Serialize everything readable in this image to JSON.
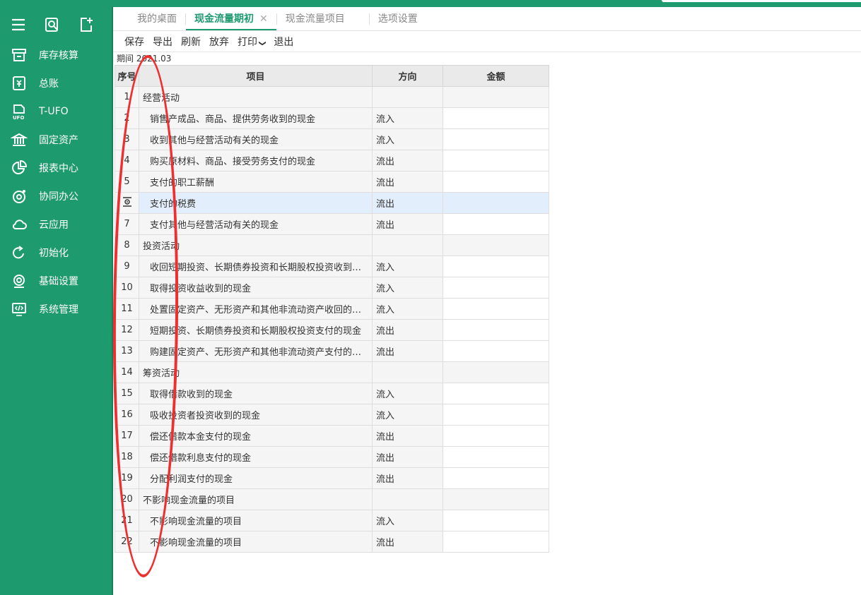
{
  "colors": {
    "brand": "#1e9a6f",
    "selected_row": "#e2eefb",
    "annotation": "#ee2f2f"
  },
  "sidebar": {
    "tools": [
      {
        "icon": "hamburger-icon"
      },
      {
        "icon": "search-doc-icon"
      },
      {
        "icon": "add-doc-icon"
      }
    ],
    "items": [
      {
        "label": "库存核算",
        "icon": "inventory-icon"
      },
      {
        "label": "总账",
        "icon": "ledger-icon"
      },
      {
        "label": "T-UFO",
        "icon": "ufo-icon"
      },
      {
        "label": "固定资产",
        "icon": "bank-icon"
      },
      {
        "label": "报表中心",
        "icon": "pie-chart-icon"
      },
      {
        "label": "协同办公",
        "icon": "collab-icon"
      },
      {
        "label": "云应用",
        "icon": "cloud-icon"
      },
      {
        "label": "初始化",
        "icon": "refresh-icon"
      },
      {
        "label": "基础设置",
        "icon": "gear-icon"
      },
      {
        "label": "系统管理",
        "icon": "monitor-code-icon"
      }
    ]
  },
  "tabs": [
    {
      "label": "我的桌面",
      "active": false
    },
    {
      "label": "现金流量期初",
      "active": true,
      "close": "✕"
    },
    {
      "label": "现金流量项目",
      "active": false
    },
    {
      "label": "选项设置",
      "active": false
    }
  ],
  "toolbar": {
    "save": "保存",
    "export": "导出",
    "refresh": "刷新",
    "discard": "放弃",
    "print": "打印",
    "print_arrow": "❯",
    "exit": "退出"
  },
  "period": "期间 2021.03",
  "table": {
    "headers": {
      "index": "序号",
      "item": "项目",
      "direction": "方向",
      "amount": "金额"
    },
    "rows": [
      {
        "idx": "1",
        "item": "经营活动",
        "dir": "",
        "group": true
      },
      {
        "idx": "2",
        "item": "销售产成品、商品、提供劳务收到的现金",
        "dir": "流入"
      },
      {
        "idx": "3",
        "item": "收到其他与经营活动有关的现金",
        "dir": "流入"
      },
      {
        "idx": "4",
        "item": "购买原材料、商品、接受劳务支付的现金",
        "dir": "流出"
      },
      {
        "idx": "5",
        "item": "支付的职工薪酬",
        "dir": "流出"
      },
      {
        "idx": "",
        "item": "支付的税费",
        "dir": "流出",
        "selected": true
      },
      {
        "idx": "7",
        "item": "支付其他与经营活动有关的现金",
        "dir": "流出"
      },
      {
        "idx": "8",
        "item": "投资活动",
        "dir": "",
        "group": true
      },
      {
        "idx": "9",
        "item": "收回短期投资、长期债券投资和长期股权投资收到…",
        "dir": "流入"
      },
      {
        "idx": "10",
        "item": "取得投资收益收到的现金",
        "dir": "流入"
      },
      {
        "idx": "11",
        "item": "处置固定资产、无形资产和其他非流动资产收回的…",
        "dir": "流入"
      },
      {
        "idx": "12",
        "item": "短期投资、长期债券投资和长期股权投资支付的现金",
        "dir": "流出"
      },
      {
        "idx": "13",
        "item": "购建固定资产、无形资产和其他非流动资产支付的…",
        "dir": "流出"
      },
      {
        "idx": "14",
        "item": "筹资活动",
        "dir": "",
        "group": true
      },
      {
        "idx": "15",
        "item": "取得借款收到的现金",
        "dir": "流入"
      },
      {
        "idx": "16",
        "item": "吸收投资者投资收到的现金",
        "dir": "流入"
      },
      {
        "idx": "17",
        "item": "偿还借款本金支付的现金",
        "dir": "流出"
      },
      {
        "idx": "18",
        "item": "偿还借款利息支付的现金",
        "dir": "流出"
      },
      {
        "idx": "19",
        "item": "分配利润支付的现金",
        "dir": "流出"
      },
      {
        "idx": "20",
        "item": "不影响现金流量的项目",
        "dir": "",
        "group": true
      },
      {
        "idx": "21",
        "item": "不影响现金流量的项目",
        "dir": "流入"
      },
      {
        "idx": "22",
        "item": "不影响现金流量的项目",
        "dir": "流出"
      }
    ]
  }
}
